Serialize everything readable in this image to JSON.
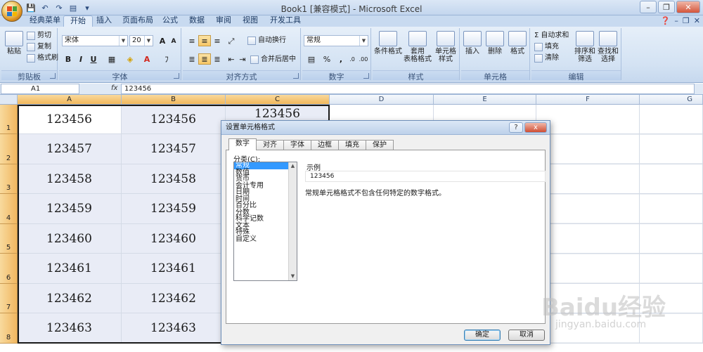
{
  "window": {
    "title": "Book1  [兼容模式] - Microsoft Excel"
  },
  "qat": {
    "icons": [
      "save-icon",
      "undo-icon",
      "redo-icon",
      "paste-icon",
      "customize-icon"
    ]
  },
  "tabs": [
    {
      "label": "经典菜单"
    },
    {
      "label": "开始"
    },
    {
      "label": "插入"
    },
    {
      "label": "页面布局"
    },
    {
      "label": "公式"
    },
    {
      "label": "数据"
    },
    {
      "label": "审阅"
    },
    {
      "label": "视图"
    },
    {
      "label": "开发工具"
    }
  ],
  "ribbon": {
    "clipboard": {
      "label": "剪贴板",
      "paste": "粘贴",
      "cut": "剪切",
      "copy": "复制",
      "format_painter": "格式刷"
    },
    "font": {
      "label": "字体",
      "font_name": "宋体",
      "font_size": "20",
      "grow": "A",
      "shrink": "A",
      "bold": "B",
      "italic": "I",
      "underline": "U",
      "font_color": "A",
      "phonetic": "ﾌ"
    },
    "alignment": {
      "label": "对齐方式",
      "wrap_text": "自动换行",
      "merge_center": "合并后居中"
    },
    "number": {
      "label": "数字",
      "format": "常规",
      "percent": "%",
      "comma": ","
    },
    "styles": {
      "label": "样式",
      "conditional": "条件格式",
      "table": "套用\n表格格式",
      "cell_styles": "单元格\n样式"
    },
    "cells": {
      "label": "单元格",
      "insert": "插入",
      "delete": "删除",
      "format": "格式"
    },
    "editing": {
      "label": "编辑",
      "autosum": "自动求和",
      "fill": "填充",
      "clear": "清除",
      "sort": "排序和\n筛选",
      "find": "查找和\n选择"
    }
  },
  "formula_bar": {
    "name_box": "A1",
    "fx": "fx",
    "value": "123456"
  },
  "grid": {
    "columns": [
      "A",
      "B",
      "C",
      "D",
      "E",
      "F",
      "G"
    ],
    "rows": [
      "1",
      "2",
      "3",
      "4",
      "5",
      "6",
      "7",
      "8"
    ],
    "colA": [
      "123456",
      "123457",
      "123458",
      "123459",
      "123460",
      "123461",
      "123462",
      "123463"
    ],
    "colB": [
      "123456",
      "123457",
      "123458",
      "123459",
      "123460",
      "123461",
      "123462",
      "123463"
    ],
    "colC_peek": "123456"
  },
  "dialog": {
    "title": "设置单元格格式",
    "help": "?",
    "close": "x",
    "tabs": [
      "数字",
      "对齐",
      "字体",
      "边框",
      "填充",
      "保护"
    ],
    "category_label": "分类(C):",
    "categories": [
      "常规",
      "数值",
      "货币",
      "会计专用",
      "日期",
      "时间",
      "百分比",
      "分数",
      "科学记数",
      "文本",
      "特殊",
      "自定义"
    ],
    "sample_label": "示例",
    "sample_value": "123456",
    "description": "常规单元格格式不包含任何特定的数字格式。",
    "ok": "确定",
    "cancel": "取消"
  },
  "watermark": {
    "main": "Baidu经验",
    "sub": "jingyan.baidu.com"
  }
}
